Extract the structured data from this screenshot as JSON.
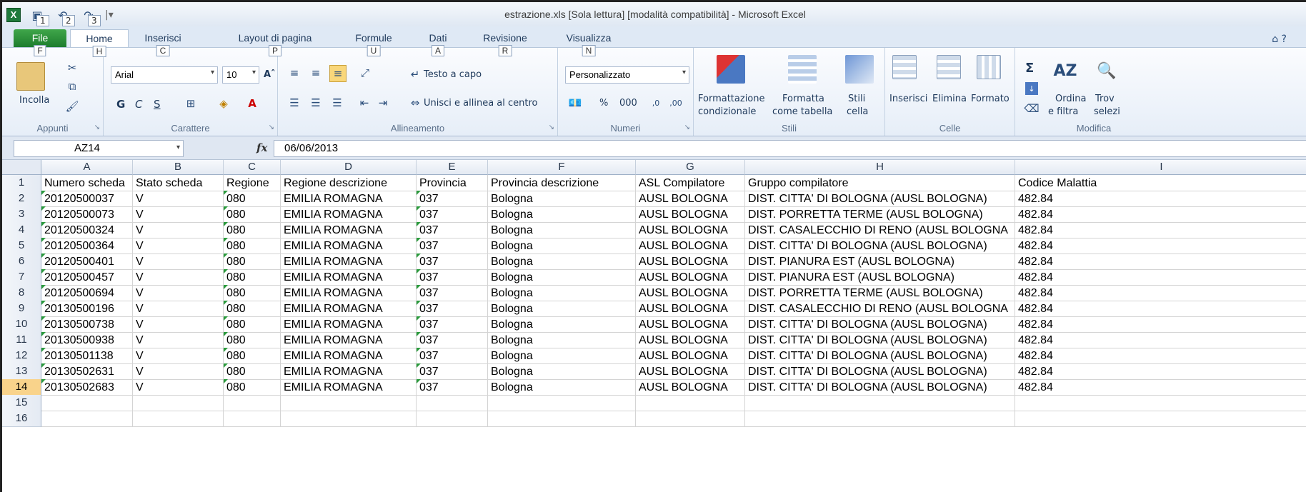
{
  "app": {
    "title": "estrazione.xls  [Sola lettura]  [modalità compatibilità]  -  Microsoft Excel",
    "logo": "X",
    "qat_keys": [
      "1",
      "2",
      "3"
    ]
  },
  "tabs": [
    {
      "label": "File",
      "key": "F"
    },
    {
      "label": "Home",
      "key": "H"
    },
    {
      "label": "Inserisci",
      "key": "C"
    },
    {
      "label": "Layout di pagina",
      "key": "P"
    },
    {
      "label": "Formule",
      "key": "U"
    },
    {
      "label": "Dati",
      "key": "A"
    },
    {
      "label": "Revisione",
      "key": "R"
    },
    {
      "label": "Visualizza",
      "key": "N"
    }
  ],
  "ribbon": {
    "appunti": {
      "label": "Appunti",
      "incolla": "Incolla"
    },
    "carattere": {
      "label": "Carattere",
      "font": "Arial",
      "size": "10",
      "bold": "G",
      "italic": "C",
      "underline": "S"
    },
    "allineamento": {
      "label": "Allineamento",
      "wrap": "Testo a capo",
      "merge": "Unisci e allinea al centro"
    },
    "numeri": {
      "label": "Numeri",
      "format": "Personalizzato",
      "percent": "%",
      "thousands": "000"
    },
    "stili": {
      "label": "Stili",
      "cond1": "Formattazione",
      "cond2": "condizionale",
      "table1": "Formatta",
      "table2": "come tabella",
      "cell1": "Stili",
      "cell2": "cella"
    },
    "celle": {
      "label": "Celle",
      "insert": "Inserisci",
      "delete": "Elimina",
      "format": "Formato"
    },
    "modifica": {
      "label": "Modifica",
      "sort1": "Ordina",
      "sort2": "e filtra",
      "find1": "Trov",
      "find2": "selezi",
      "sigma": "Σ"
    }
  },
  "formula_bar": {
    "name_box": "AZ14",
    "fx": "fx",
    "value": "06/06/2013"
  },
  "sheet": {
    "columns": [
      "A",
      "B",
      "C",
      "D",
      "E",
      "F",
      "G",
      "H",
      "I"
    ],
    "headers": [
      "Numero scheda",
      "Stato scheda",
      "Regione",
      "Regione descrizione",
      "Provincia",
      "Provincia descrizione",
      "ASL Compilatore",
      "Gruppo compilatore",
      "Codice Malattia"
    ],
    "row_numbers": [
      "1",
      "2",
      "3",
      "4",
      "5",
      "6",
      "7",
      "8",
      "9",
      "10",
      "11",
      "12",
      "13",
      "14",
      "15",
      "16"
    ],
    "selected_row": "14",
    "rows": [
      [
        "20120500037",
        "V",
        "080",
        "EMILIA ROMAGNA",
        "037",
        "Bologna",
        "AUSL BOLOGNA",
        "DIST. CITTA' DI BOLOGNA (AUSL BOLOGNA)",
        "482.84"
      ],
      [
        "20120500073",
        "V",
        "080",
        "EMILIA ROMAGNA",
        "037",
        "Bologna",
        "AUSL BOLOGNA",
        "DIST. PORRETTA TERME (AUSL BOLOGNA)",
        "482.84"
      ],
      [
        "20120500324",
        "V",
        "080",
        "EMILIA ROMAGNA",
        "037",
        "Bologna",
        "AUSL BOLOGNA",
        "DIST. CASALECCHIO DI RENO (AUSL BOLOGNA",
        "482.84"
      ],
      [
        "20120500364",
        "V",
        "080",
        "EMILIA ROMAGNA",
        "037",
        "Bologna",
        "AUSL BOLOGNA",
        "DIST. CITTA' DI BOLOGNA (AUSL BOLOGNA)",
        "482.84"
      ],
      [
        "20120500401",
        "V",
        "080",
        "EMILIA ROMAGNA",
        "037",
        "Bologna",
        "AUSL BOLOGNA",
        "DIST. PIANURA EST (AUSL BOLOGNA)",
        "482.84"
      ],
      [
        "20120500457",
        "V",
        "080",
        "EMILIA ROMAGNA",
        "037",
        "Bologna",
        "AUSL BOLOGNA",
        "DIST. PIANURA EST (AUSL BOLOGNA)",
        "482.84"
      ],
      [
        "20120500694",
        "V",
        "080",
        "EMILIA ROMAGNA",
        "037",
        "Bologna",
        "AUSL BOLOGNA",
        "DIST. PORRETTA TERME (AUSL BOLOGNA)",
        "482.84"
      ],
      [
        "20130500196",
        "V",
        "080",
        "EMILIA ROMAGNA",
        "037",
        "Bologna",
        "AUSL BOLOGNA",
        "DIST. CASALECCHIO DI RENO (AUSL BOLOGNA",
        "482.84"
      ],
      [
        "20130500738",
        "V",
        "080",
        "EMILIA ROMAGNA",
        "037",
        "Bologna",
        "AUSL BOLOGNA",
        "DIST. CITTA' DI BOLOGNA (AUSL BOLOGNA)",
        "482.84"
      ],
      [
        "20130500938",
        "V",
        "080",
        "EMILIA ROMAGNA",
        "037",
        "Bologna",
        "AUSL BOLOGNA",
        "DIST. CITTA' DI BOLOGNA (AUSL BOLOGNA)",
        "482.84"
      ],
      [
        "20130501138",
        "V",
        "080",
        "EMILIA ROMAGNA",
        "037",
        "Bologna",
        "AUSL BOLOGNA",
        "DIST. CITTA' DI BOLOGNA (AUSL BOLOGNA)",
        "482.84"
      ],
      [
        "20130502631",
        "V",
        "080",
        "EMILIA ROMAGNA",
        "037",
        "Bologna",
        "AUSL BOLOGNA",
        "DIST. CITTA' DI BOLOGNA (AUSL BOLOGNA)",
        "482.84"
      ],
      [
        "20130502683",
        "V",
        "080",
        "EMILIA ROMAGNA",
        "037",
        "Bologna",
        "AUSL BOLOGNA",
        "DIST. CITTA' DI BOLOGNA (AUSL BOLOGNA)",
        "482.84"
      ]
    ]
  },
  "icons": {
    "save": "save-icon",
    "undo": "undo-icon",
    "redo": "redo-icon",
    "help": "help-icon"
  },
  "colors": {
    "file_tab": "#1c7b2c",
    "selected_row": "#f9d38b",
    "green_triangle": "#2a9a3c"
  }
}
